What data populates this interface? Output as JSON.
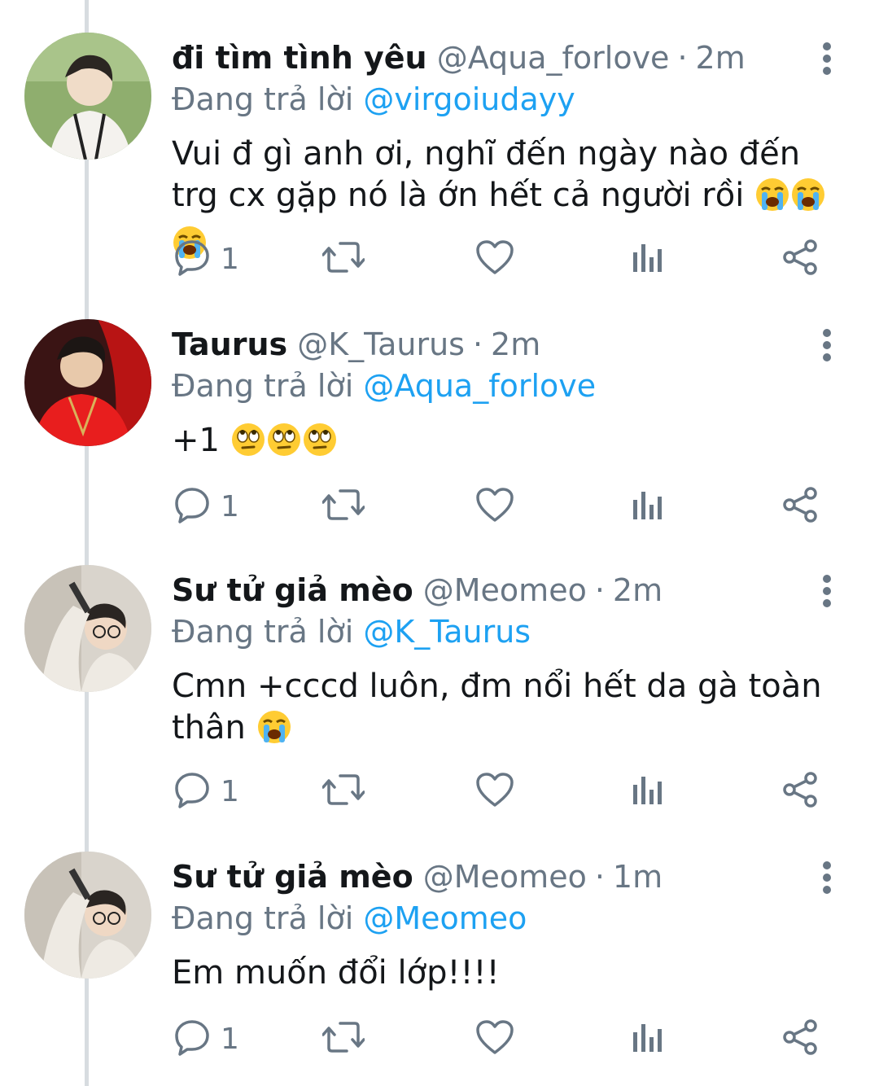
{
  "colors": {
    "accent": "#1da1f2",
    "secondary_text": "#687684",
    "primary_text": "#14171a",
    "thread_line": "#d7dce0"
  },
  "tweets": [
    {
      "display_name": "đi tìm tình yêu",
      "handle": "@Aqua_forlove",
      "separator": "·",
      "time": "2m",
      "reply_prefix": "Đang trả lời",
      "reply_to": "@virgoiudayy",
      "body": "Vui đ gì anh ơi, nghĩ đến ngày nào đến trg cx gặp nó là ớn hết cả người rồi",
      "emoji_icons": [
        "loudly-crying-face-icon",
        "loudly-crying-face-icon",
        "loudly-crying-face-icon"
      ],
      "reply_count": "1"
    },
    {
      "display_name": "Taurus",
      "handle": "@K_Taurus",
      "separator": "·",
      "time": "2m",
      "reply_prefix": "Đang trả lời",
      "reply_to": "@Aqua_forlove",
      "body": "+1",
      "emoji_icons": [
        "eye-roll-face-icon",
        "eye-roll-face-icon",
        "eye-roll-face-icon"
      ],
      "reply_count": "1"
    },
    {
      "display_name": "Sư tử giả mèo",
      "handle": "@Meomeo",
      "separator": "·",
      "time": "2m",
      "reply_prefix": "Đang trả lời",
      "reply_to": "@K_Taurus",
      "body": "Cmn +cccd luôn, đm nổi hết da gà toàn thân",
      "emoji_icons": [
        "loudly-crying-face-icon"
      ],
      "reply_count": "1"
    },
    {
      "display_name": "Sư tử giả mèo",
      "handle": "@Meomeo",
      "separator": "·",
      "time": "1m",
      "reply_prefix": "Đang trả lời",
      "reply_to": "@Meomeo",
      "body": "Em muốn đổi lớp!!!!",
      "emoji_icons": [],
      "reply_count": "1"
    }
  ],
  "action_icons": [
    "reply-icon",
    "retweet-icon",
    "like-icon",
    "analytics-icon",
    "share-icon"
  ]
}
